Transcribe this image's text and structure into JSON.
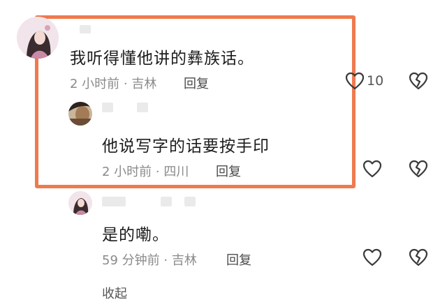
{
  "comments": [
    {
      "text": "我听得懂他讲的彝族话。",
      "time": "2 小时前",
      "separator": "·",
      "location": "吉林",
      "reply_label": "回复",
      "like_count": "10"
    },
    {
      "text": "他说写字的话要按手印",
      "time": "2 小时前",
      "separator": "·",
      "location": "四川",
      "reply_label": "回复",
      "like_count": ""
    },
    {
      "text": "是的嘞。",
      "time": "59 分钟前",
      "separator": "·",
      "location": "吉林",
      "reply_label": "回复",
      "like_count": ""
    }
  ],
  "footer": {
    "collapse_label": "收起"
  },
  "colors": {
    "highlight": "#ef7a4e",
    "meta": "#8a8a8a",
    "icon": "#3a3a3a"
  },
  "icons": [
    "heart-icon",
    "broken-heart-icon"
  ]
}
